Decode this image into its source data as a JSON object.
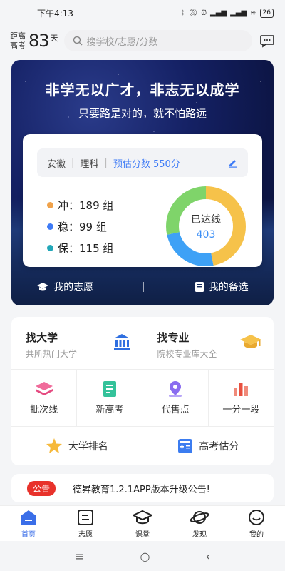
{
  "status_bar": {
    "time": "下午4:13",
    "battery": "26"
  },
  "header": {
    "countdown_label": "距离高考",
    "countdown_days": "83",
    "countdown_unit": "天",
    "search_placeholder": "搜学校/志愿/分数"
  },
  "banner": {
    "title": "非学无以广才，非志无以成学",
    "subtitle": "只要路是对的，就不怕路远",
    "province": "安徽",
    "subject": "理科",
    "estimated_score": "预估分数 550分",
    "stats": [
      {
        "label": "冲：189 组",
        "color": "#f0a24a"
      },
      {
        "label": "稳：99 组",
        "color": "#3e7bf6"
      },
      {
        "label": "保：115 组",
        "color": "#22a7b8"
      }
    ],
    "donut": {
      "label": "已达线",
      "value": "403",
      "segments": [
        {
          "value": 189,
          "color": "#f6c24a"
        },
        {
          "value": 99,
          "color": "#3ea1f6"
        },
        {
          "value": 115,
          "color": "#7fd46a"
        }
      ]
    },
    "links": {
      "my_wishes": "我的志愿",
      "my_backup": "我的备选"
    }
  },
  "features": {
    "find_university": {
      "title": "找大学",
      "subtitle": "共所热门大学"
    },
    "find_major": {
      "title": "找专业",
      "subtitle": "院校专业库大全"
    },
    "tools": [
      {
        "label": "批次线",
        "icon": "layers-icon"
      },
      {
        "label": "新高考",
        "icon": "document-icon"
      },
      {
        "label": "代售点",
        "icon": "map-pin-icon"
      },
      {
        "label": "一分一段",
        "icon": "bar-chart-icon"
      }
    ],
    "university_ranking": "大学排名",
    "score_estimate": "高考估分"
  },
  "notice": {
    "tag": "公告",
    "text": "德昇教育1.2.1APP版本升级公告!"
  },
  "tabbar": [
    {
      "label": "首页",
      "active": true
    },
    {
      "label": "志愿",
      "active": false
    },
    {
      "label": "课堂",
      "active": false
    },
    {
      "label": "发现",
      "active": false
    },
    {
      "label": "我的",
      "active": false
    }
  ],
  "sysnav": {
    "menu": "≡",
    "home": "○",
    "back": "‹"
  }
}
